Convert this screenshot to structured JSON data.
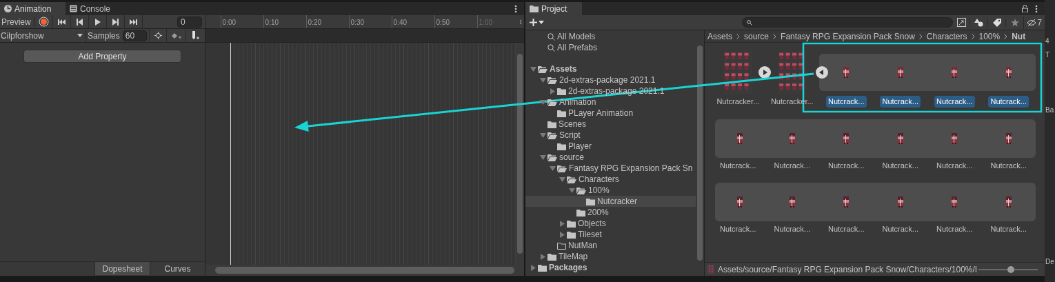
{
  "animation": {
    "tabs": [
      {
        "label": "Animation",
        "selected": true,
        "kind": "clock"
      },
      {
        "label": "Console",
        "selected": false,
        "kind": "console"
      }
    ],
    "preview_label": "Preview",
    "recording": false,
    "frame": "0",
    "clip": "Cilpforshow",
    "samples_label": "Samples",
    "samples": "60",
    "add_property": "Add Property",
    "ticks": [
      "0:00",
      "0:10",
      "0:20",
      "0:30",
      "0:40",
      "0:50",
      "1:00"
    ],
    "view_tabs": [
      {
        "label": "Dopesheet",
        "selected": true
      },
      {
        "label": "Curves",
        "selected": false
      }
    ]
  },
  "project": {
    "tab": "Project",
    "hidden_count": "7",
    "breadcrumb": [
      "Assets",
      "source",
      "Fantasy RPG Expansion Pack Snow",
      "Characters",
      "100%",
      "Nut"
    ],
    "favorites": [
      "All Models",
      "All Prefabs"
    ],
    "tree": [
      {
        "label": "Assets",
        "bold": true,
        "expanded": true,
        "empty": false,
        "selected": false,
        "children": [
          {
            "label": "2d-extras-package 2021.1",
            "bold": false,
            "expanded": true,
            "empty": false,
            "selected": false,
            "children": [
              {
                "label": "2d-extras-package 2021.1",
                "bold": false,
                "expanded": false,
                "empty": false,
                "selected": false
              }
            ]
          },
          {
            "label": "Animation",
            "bold": false,
            "expanded": true,
            "empty": false,
            "selected": false,
            "children": [
              {
                "label": "PLayer Animation",
                "bold": false,
                "empty": false,
                "selected": false
              }
            ]
          },
          {
            "label": "Scenes",
            "bold": false,
            "empty": false,
            "selected": false
          },
          {
            "label": "Script",
            "bold": false,
            "expanded": true,
            "empty": false,
            "selected": false,
            "children": [
              {
                "label": "Player",
                "bold": false,
                "empty": false,
                "selected": false
              }
            ]
          },
          {
            "label": "source",
            "bold": false,
            "expanded": true,
            "empty": false,
            "selected": false,
            "children": [
              {
                "label": "Fantasy RPG Expansion Pack Sn",
                "bold": false,
                "expanded": true,
                "empty": false,
                "selected": false,
                "children": [
                  {
                    "label": "Characters",
                    "bold": false,
                    "expanded": true,
                    "empty": false,
                    "selected": false,
                    "children": [
                      {
                        "label": "100%",
                        "bold": false,
                        "expanded": true,
                        "empty": false,
                        "selected": false,
                        "children": [
                          {
                            "label": "Nutcracker",
                            "bold": false,
                            "empty": false,
                            "selected": true
                          }
                        ]
                      },
                      {
                        "label": "200%",
                        "bold": false,
                        "empty": false,
                        "selected": false
                      }
                    ]
                  },
                  {
                    "label": "Objects",
                    "bold": false,
                    "expanded": false,
                    "empty": false,
                    "selected": false
                  },
                  {
                    "label": "Tileset",
                    "bold": false,
                    "expanded": false,
                    "empty": false,
                    "selected": false
                  }
                ]
              },
              {
                "label": "NutMan",
                "bold": false,
                "empty": true,
                "selected": false
              }
            ]
          },
          {
            "label": "TileMap",
            "bold": false,
            "expanded": false,
            "empty": false,
            "selected": false
          }
        ]
      },
      {
        "label": "Packages",
        "bold": true,
        "expanded": false,
        "empty": false,
        "selected": false
      }
    ],
    "sheets": [
      {
        "label": "Nutcracker...",
        "expanded": false
      },
      {
        "label": "Nutcracker...",
        "expanded": true,
        "sprites": [
          {
            "label": "Nutcrack...",
            "selected": true
          },
          {
            "label": "Nutcrack...",
            "selected": true
          },
          {
            "label": "Nutcrack...",
            "selected": true
          },
          {
            "label": "Nutcrack...",
            "selected": true
          },
          {
            "label": "Nutcrack...",
            "selected": false
          },
          {
            "label": "Nutcrack...",
            "selected": false
          },
          {
            "label": "Nutcrack...",
            "selected": false
          },
          {
            "label": "Nutcrack...",
            "selected": false
          },
          {
            "label": "Nutcrack...",
            "selected": false
          },
          {
            "label": "Nutcrack...",
            "selected": false
          },
          {
            "label": "Nutcrack...",
            "selected": false
          },
          {
            "label": "Nutcrack...",
            "selected": false
          },
          {
            "label": "Nutcrack...",
            "selected": false
          },
          {
            "label": "Nutcrack...",
            "selected": false
          },
          {
            "label": "Nutcrack...",
            "selected": false
          },
          {
            "label": "Nutcrack...",
            "selected": false
          }
        ]
      }
    ],
    "path": "Assets/source/Fantasy RPG Expansion Pack Snow/Characters/100%/I",
    "zoom": {
      "level": 0.55
    }
  },
  "inspector_edge": [
    "4",
    "T",
    "Ba",
    "De"
  ]
}
